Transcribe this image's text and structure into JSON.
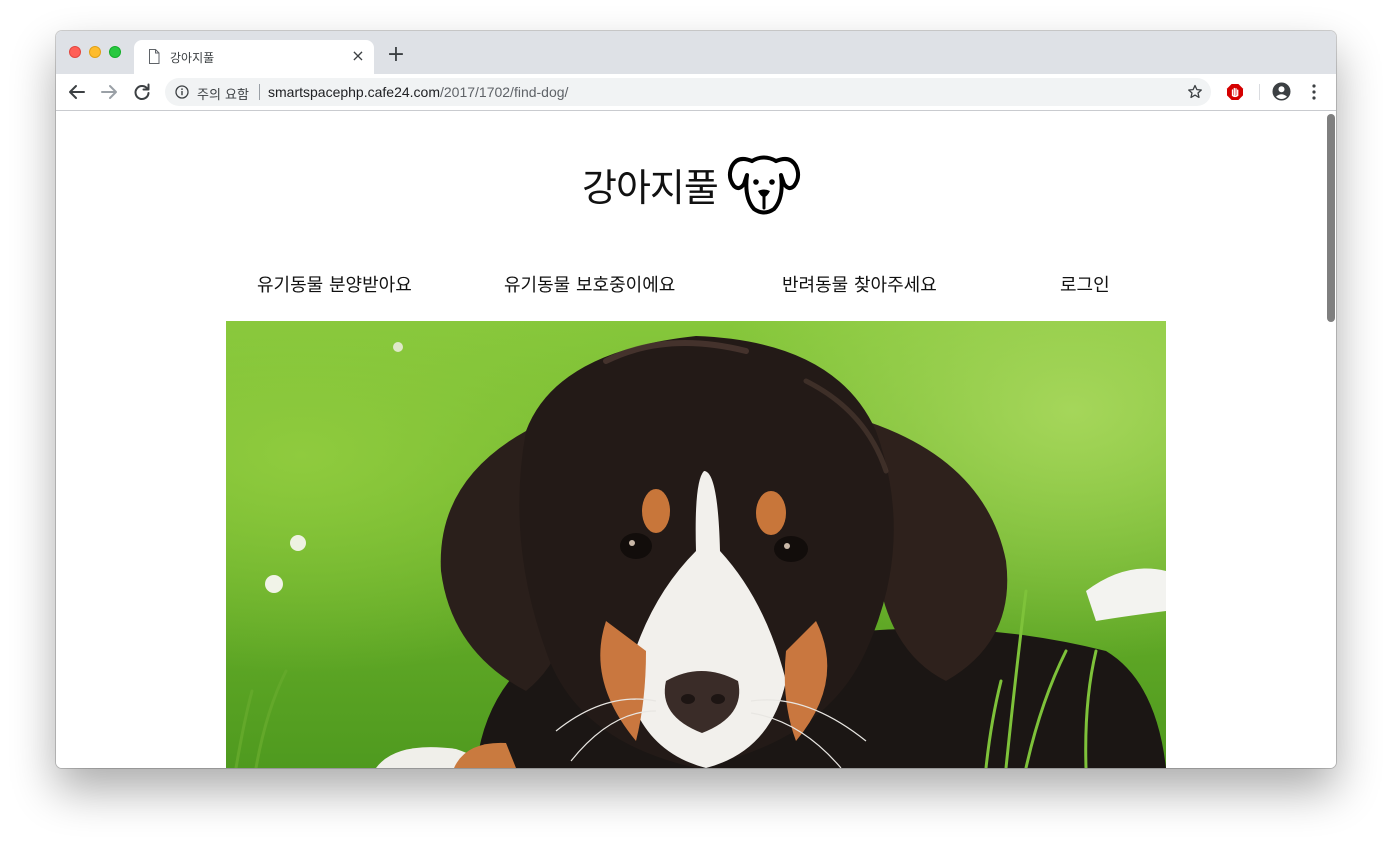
{
  "browser": {
    "tab_title": "강아지풀",
    "tab_close_glyph": "×",
    "new_tab_glyph": "+",
    "security_label": "주의 요함",
    "url_host": "smartspacephp.cafe24.com",
    "url_path": "/2017/1702/find-dog/",
    "icons": [
      "back-icon",
      "forward-icon",
      "reload-icon",
      "info-icon",
      "star-icon",
      "adblock-icon",
      "profile-icon",
      "menu-icon"
    ]
  },
  "site": {
    "title": "강아지풀",
    "logo_icon": "dog-face-icon",
    "nav": [
      {
        "label": "유기동물 분양받아요"
      },
      {
        "label": "유기동물 보호중이에요"
      },
      {
        "label": "반려동물 찾아주세요"
      },
      {
        "label": "로그인"
      }
    ],
    "hero_image": "bernese-puppy-on-grass"
  },
  "colors": {
    "tabstrip": "#dee1e6",
    "omnibox": "#f1f3f4",
    "traffic_close": "#ff5f57",
    "traffic_min": "#febc2e",
    "traffic_max": "#28c840",
    "adblock_red": "#d50000",
    "grass": "#6fb52c"
  }
}
